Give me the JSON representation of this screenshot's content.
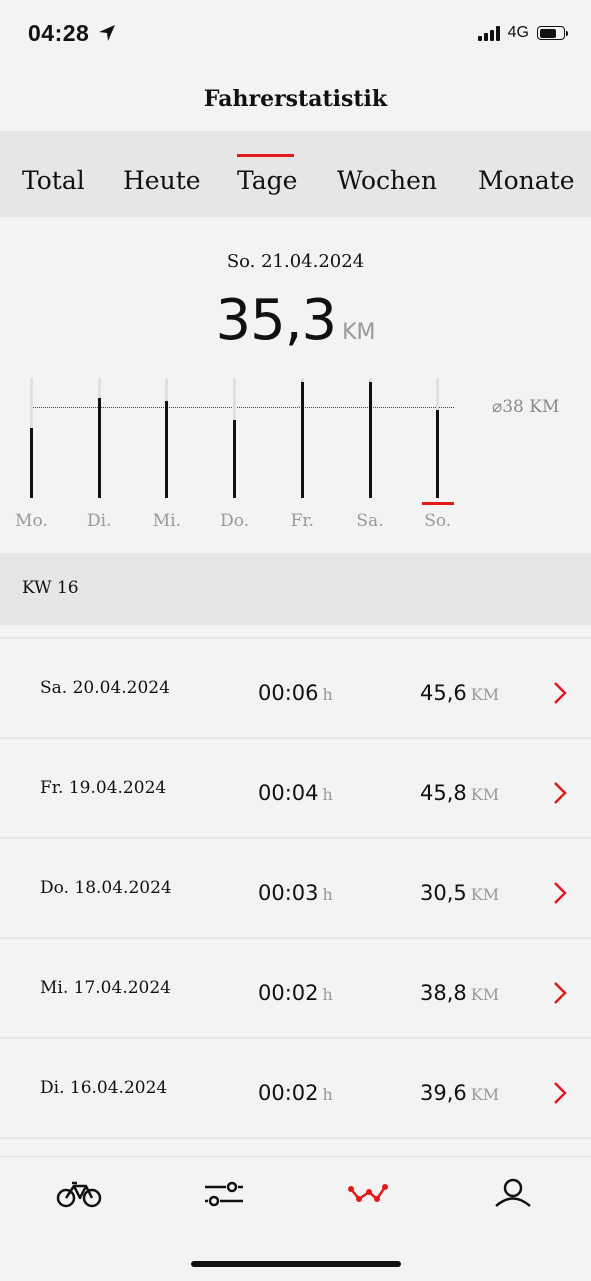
{
  "status": {
    "time": "04:28",
    "network": "4G"
  },
  "title": "Fahrerstatistik",
  "tabs": [
    {
      "label": "Total",
      "active": false
    },
    {
      "label": "Heute",
      "active": false
    },
    {
      "label": "Tage",
      "active": true
    },
    {
      "label": "Wochen",
      "active": false
    },
    {
      "label": "Monate",
      "active": false
    }
  ],
  "summary": {
    "date": "So. 21.04.2024",
    "value": "35,3",
    "unit": "KM"
  },
  "chart_data": {
    "type": "bar",
    "categories": [
      "Mo.",
      "Di.",
      "Mi.",
      "Do.",
      "Fr.",
      "Sa.",
      "So."
    ],
    "values": [
      29.2,
      41.5,
      40.5,
      32.5,
      48.3,
      48.3,
      36.5
    ],
    "average_label": "⌀38 KM",
    "average": 38,
    "ylim": [
      0,
      50
    ],
    "selected_index": 6,
    "accent": "#e21a1a"
  },
  "week": {
    "label": "KW 16"
  },
  "rows": [
    {
      "date": "Sa. 20.04.2024",
      "time": "00:06",
      "time_unit": "h",
      "dist": "45,6",
      "dist_unit": "KM"
    },
    {
      "date": "Fr. 19.04.2024",
      "time": "00:04",
      "time_unit": "h",
      "dist": "45,8",
      "dist_unit": "KM"
    },
    {
      "date": "Do. 18.04.2024",
      "time": "00:03",
      "time_unit": "h",
      "dist": "30,5",
      "dist_unit": "KM"
    },
    {
      "date": "Mi. 17.04.2024",
      "time": "00:02",
      "time_unit": "h",
      "dist": "38,8",
      "dist_unit": "KM"
    },
    {
      "date": "Di. 16.04.2024",
      "time": "00:02",
      "time_unit": "h",
      "dist": "39,6",
      "dist_unit": "KM"
    }
  ],
  "nav": [
    {
      "icon": "bike-icon",
      "active": false
    },
    {
      "icon": "sliders-icon",
      "active": false
    },
    {
      "icon": "statistics-icon",
      "active": true
    },
    {
      "icon": "profile-icon",
      "active": false
    }
  ]
}
